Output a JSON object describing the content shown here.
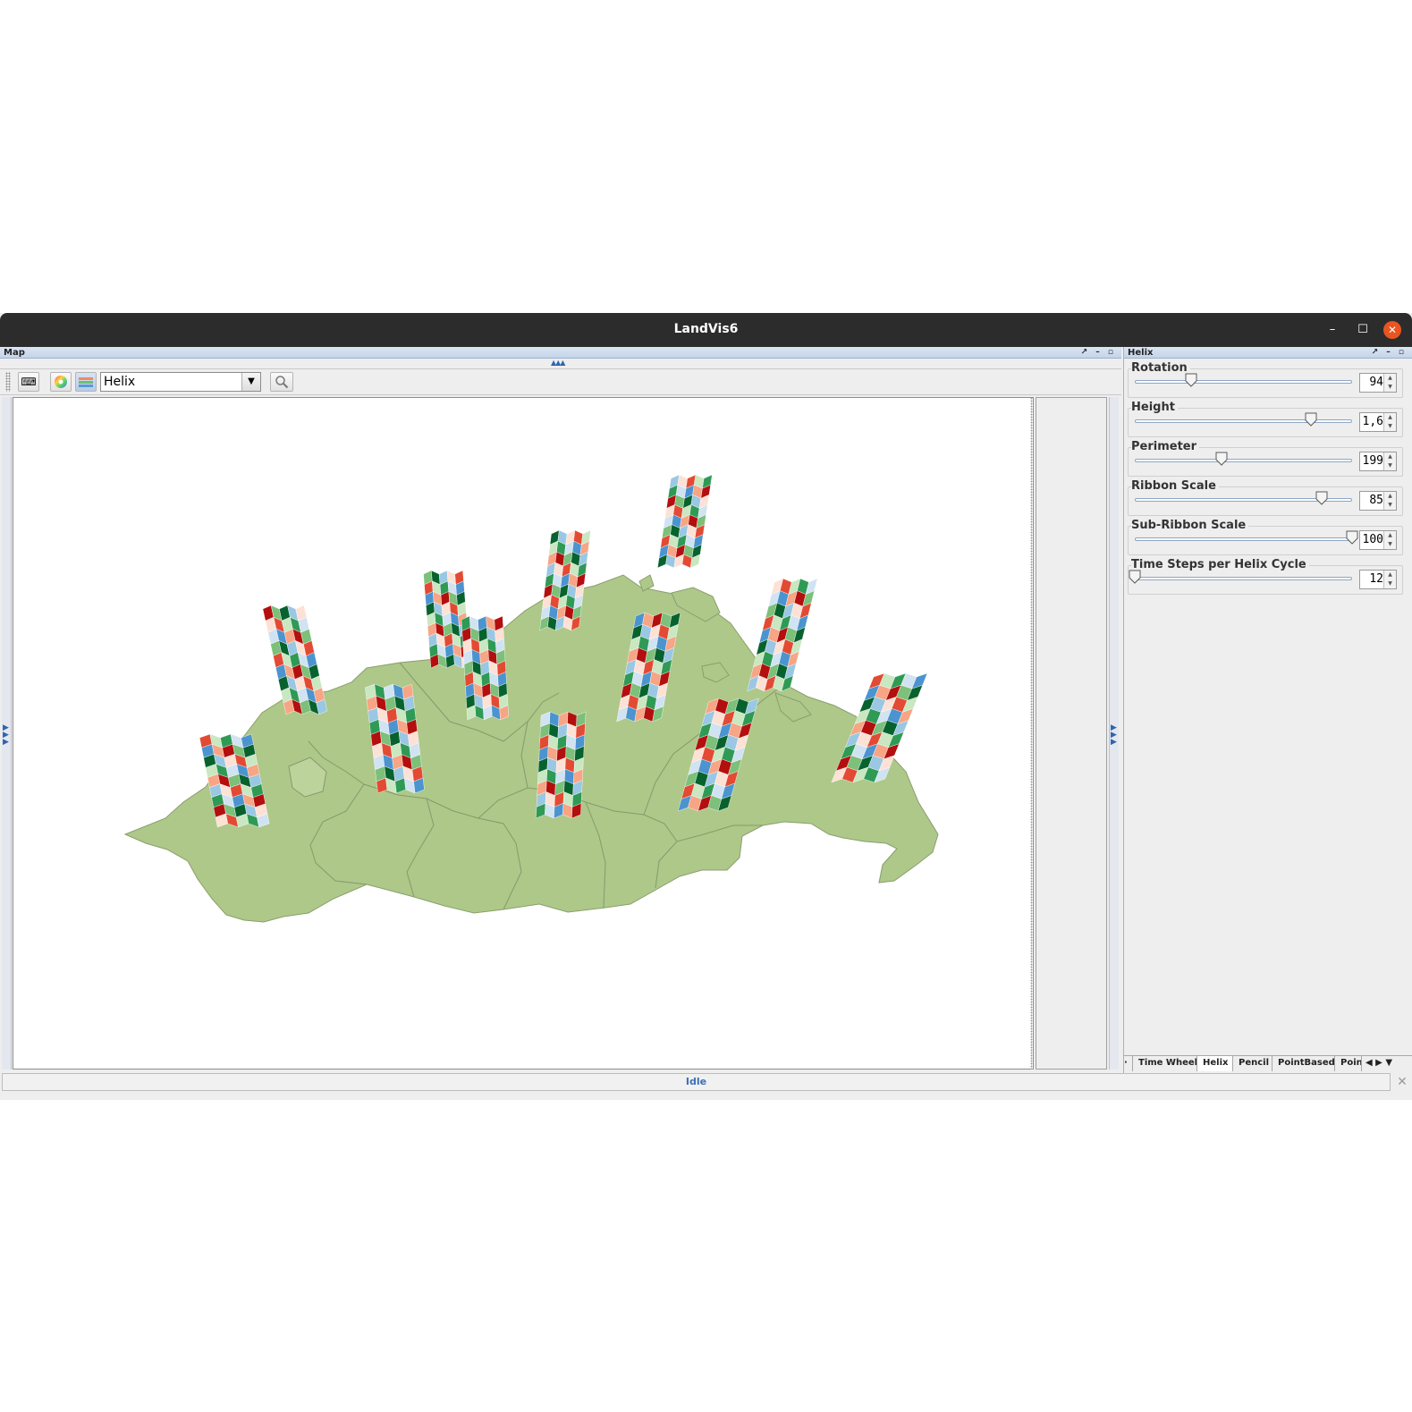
{
  "window": {
    "title": "LandVis6",
    "min_glyph": "–",
    "max_glyph": "☐",
    "close_glyph": "✕"
  },
  "map_panel": {
    "title": "Map",
    "header_icons": "↗ – ▫",
    "collapse_glyph": "▲▲▲"
  },
  "toolbar": {
    "keyboard_icon": "⌨",
    "colorwheel_icon": "◉",
    "helix_icon": "≋",
    "view_select": "Helix",
    "dropdown_glyph": "▼",
    "zoom_icon": "🔍"
  },
  "helix_panel": {
    "title": "Helix",
    "header_icons": "↗ – ▫",
    "controls": [
      {
        "label": "Rotation",
        "value": "94",
        "slider_fraction": 0.26
      },
      {
        "label": "Height",
        "value": "1,6",
        "slider_fraction": 0.81
      },
      {
        "label": "Perimeter",
        "value": "199",
        "slider_fraction": 0.4
      },
      {
        "label": "Ribbon Scale",
        "value": "85",
        "slider_fraction": 0.86
      },
      {
        "label": "Sub-Ribbon Scale",
        "value": "100",
        "slider_fraction": 1.0
      },
      {
        "label": "Time Steps per Helix Cycle",
        "value": "12",
        "slider_fraction": 0.0
      }
    ],
    "tabs": [
      "Time Wheel",
      "Helix",
      "Pencil",
      "PointBased",
      "Point"
    ],
    "active_tab": "Helix",
    "tab_nav": "◀ ▶ ▼"
  },
  "status": {
    "text": "Idle",
    "close_glyph": "✕"
  },
  "colors": {
    "land": "#adc889",
    "border": "#7d8c6a",
    "titlebar": "#2c2c2c",
    "close": "#e95420",
    "helix_palette": [
      "#fde1d4",
      "#f7a585",
      "#e34a33",
      "#b30f0f",
      "#c9e7c0",
      "#7cc07a",
      "#2f9a55",
      "#08622e",
      "#d1e3f2",
      "#9ac7e3",
      "#4b94cf"
    ]
  }
}
